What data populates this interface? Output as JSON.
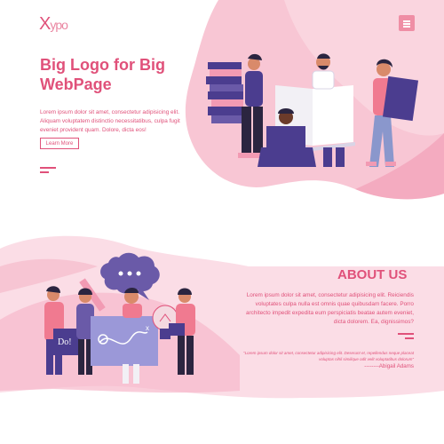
{
  "header": {
    "logo_x": "X",
    "logo_rest": "ypo",
    "menu_icon": "hamburger-icon"
  },
  "hero": {
    "title": "Big Logo for Big WebPage",
    "text": "Lorem ipsum dolor sit amet, consectetur adipisicing elit. Aliquam voluptatem distinctio necessitatibus, culpa fugit eveniet provident quam. Dolore, dicta eos!",
    "button_label": "Learn More",
    "illustration": "people-with-books-illustration"
  },
  "about": {
    "title": "ABOUT US",
    "text": "Lorem ipsum dolor sit amet, consectetur adipisicing elit. Reiciendis voluptates culpa nulla est omnis quae quibusdam facere. Porro architecto impedit expedita eum perspiciatis beatae autem eveniet, dicta dolorem. Ea, dignissimos?",
    "quote": "\"Lorem ipsum dolor sit amet, consectetur adipisicing elit. Deserunt et, repellendus neque placeat voluptas nihil similique odit velit voluptatibus dolorum\"",
    "author": "--------Abigail Adams",
    "illustration": "team-brainstorm-illustration"
  },
  "colors": {
    "accent": "#e0517a",
    "pink_light": "#fbdde6",
    "pink_mid": "#f5b3c6",
    "purple": "#4b3d8f"
  }
}
